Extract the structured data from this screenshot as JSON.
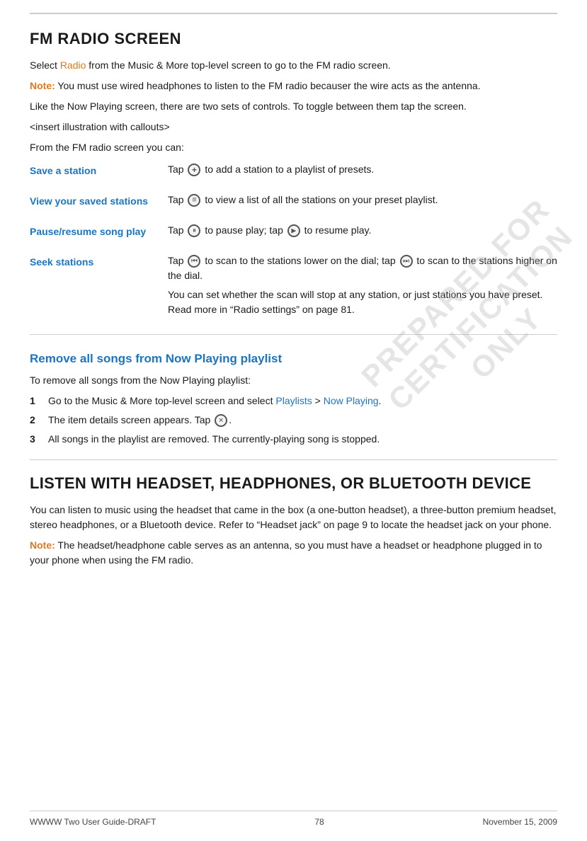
{
  "page": {
    "top_border": true
  },
  "watermark": {
    "lines": [
      "PREPARED FOR",
      "CERTIFICATION",
      "ONLY"
    ]
  },
  "fm_radio": {
    "title": "FM RADIO SCREEN",
    "intro_1": "Select ",
    "intro_radio": "Radio",
    "intro_1_rest": " from the Music & More top-level screen to go to the FM radio screen.",
    "note_label": "Note:",
    "note_text": " You must use wired headphones to listen to the FM radio becauser the wire acts as the antenna.",
    "para_2": "Like the Now Playing screen, there are two sets of controls. To toggle between them tap the screen.",
    "para_3": "<insert illustration with callouts>",
    "para_4": "From the FM radio screen you can:",
    "features": [
      {
        "label": "Save a station",
        "desc_parts": [
          "Tap  to add a station to a playlist of presets."
        ],
        "icon": "add"
      },
      {
        "label": "View your saved stations",
        "desc_parts": [
          "Tap  to view a list of all the stations on your preset playlist."
        ],
        "icon": "list"
      },
      {
        "label": "Pause/resume song play",
        "desc_parts": [
          "Tap  to pause play; tap  to resume play."
        ],
        "icon_pause": "pause",
        "icon_play": "play"
      },
      {
        "label": "Seek stations",
        "desc_parts": [
          "Tap  to scan to the stations lower on the dial; tap  to scan to the stations higher on the dial.",
          "You can set whether the scan will stop at any station, or just stations you have preset. Read more in “Radio settings” on page 81."
        ],
        "icon_prev": "prev",
        "icon_next": "next"
      }
    ]
  },
  "remove_songs": {
    "title": "Remove all songs from Now Playing playlist",
    "intro": "To remove all songs from the Now Playing playlist:",
    "steps": [
      {
        "num": "1",
        "text_before": "Go to the Music & More top-level screen and select ",
        "link1": "Playlists",
        "separator": " > ",
        "link2": "Now Playing",
        "text_after": "."
      },
      {
        "num": "2",
        "text_before": "The item details screen appears. Tap ",
        "icon": "x",
        "text_after": "."
      },
      {
        "num": "3",
        "text": "All songs in the playlist are removed. The currently-playing song is stopped."
      }
    ]
  },
  "headset": {
    "title": "LISTEN WITH HEADSET, HEADPHONES, OR BLUETOOTH DEVICE",
    "para_1": "You can listen to music using the headset that came in the box (a one-button headset), a three-button premium headset, stereo headphones, or a Bluetooth device. Refer to “Headset jack” on page 9 to locate the headset jack on your phone.",
    "note_label": "Note:",
    "note_text": " The headset/headphone cable serves as an antenna, so you must have a headset or headphone plugged in to your phone when using the FM radio."
  },
  "footer": {
    "left": "WWWW Two User Guide-DRAFT",
    "center": "78",
    "right": "November 15, 2009"
  }
}
